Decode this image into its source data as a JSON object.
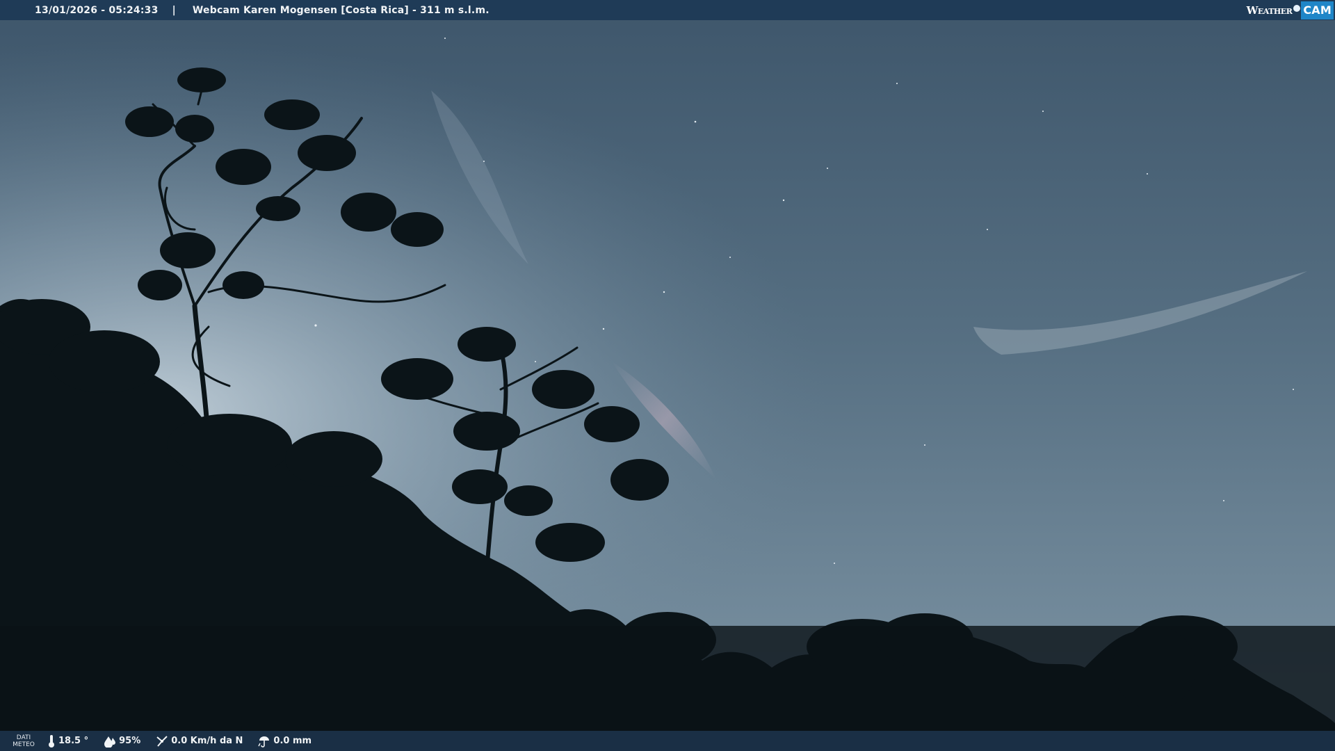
{
  "header": {
    "datetime": "13/01/2026 - 05:24:33",
    "separator": "|",
    "title": "Webcam Karen Mogensen [Costa Rica] - 311 m s.l.m."
  },
  "logo": {
    "weather_text": "Weather",
    "cam_text": "CAM"
  },
  "footer": {
    "section_label_line1": "DATI",
    "section_label_line2": "METEO",
    "temperature": "18.5 °",
    "humidity": "95%",
    "wind": "0.0 Km/h da N",
    "rain": "0.0 mm"
  },
  "icons": {
    "temperature": "thermometer-icon",
    "humidity": "water-drop-icon",
    "wind": "wind-icon",
    "rain": "rain-gauge-icon",
    "logo_dot": "camera-lens-icon"
  },
  "colors": {
    "top_bar": "#1f3b57",
    "bottom_bar": "#1a2f45",
    "logo_cam_bg": "#1f86c8",
    "sky_top": "#415a70",
    "sky_horizon": "#b3c3cf",
    "foliage": "#0b1418"
  }
}
